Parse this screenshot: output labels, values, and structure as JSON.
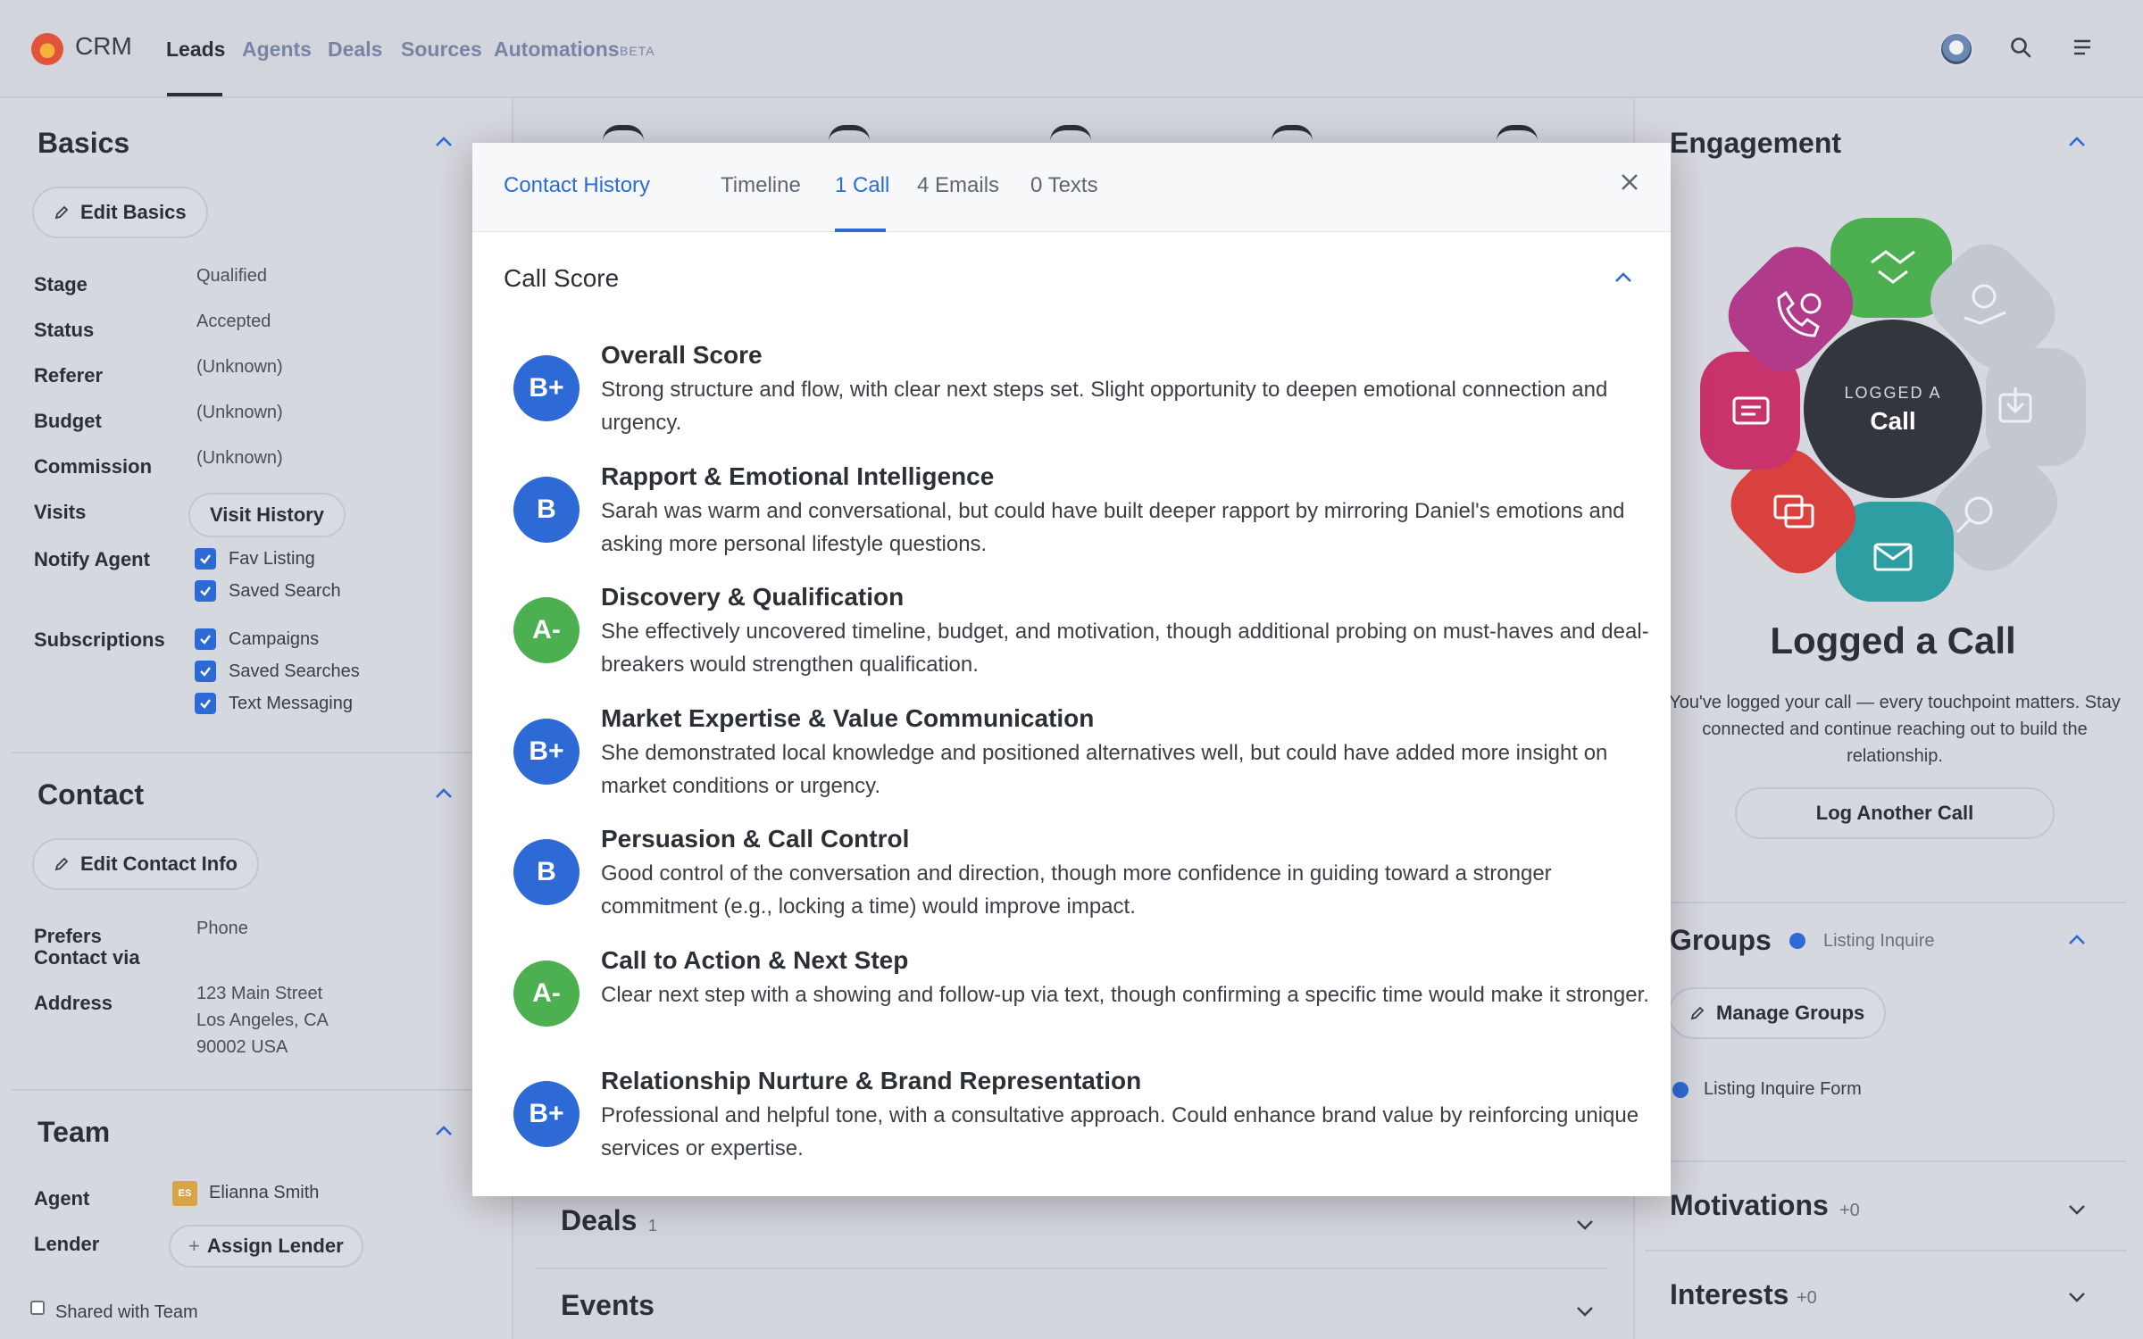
{
  "topnav": {
    "brand": "CRM",
    "items": [
      "Leads",
      "Agents",
      "Deals",
      "Sources",
      "Automations"
    ],
    "beta_badge": "BETA"
  },
  "basics": {
    "title": "Basics",
    "edit_button": "Edit Basics",
    "fields": [
      {
        "label": "Stage",
        "value": "Qualified"
      },
      {
        "label": "Status",
        "value": "Accepted"
      },
      {
        "label": "Referer",
        "value": "(Unknown)"
      },
      {
        "label": "Budget",
        "value": "(Unknown)"
      },
      {
        "label": "Commission",
        "value": "(Unknown)"
      }
    ],
    "visits_label": "Visits",
    "visit_history_button": "Visit History",
    "notify_label": "Notify Agent",
    "notify_options": [
      "Fav Listing",
      "Saved Search"
    ],
    "subscriptions_label": "Subscriptions",
    "subscription_options": [
      "Campaigns",
      "Saved Searches",
      "Text Messaging"
    ]
  },
  "contact": {
    "title": "Contact",
    "edit_button": "Edit Contact Info",
    "prefers_label_1": "Prefers",
    "prefers_label_2": "Contact via",
    "prefers_value": "Phone",
    "address_label": "Address",
    "address_line1": "123 Main Street",
    "address_line2": "Los Angeles, CA",
    "address_line3": "90002 USA"
  },
  "team": {
    "title": "Team",
    "agent_label": "Agent",
    "agent_initials": "ES",
    "agent_name": "Elianna Smith",
    "lender_label": "Lender",
    "assign_lender_button": "Assign Lender",
    "shared_label": "Shared with Team"
  },
  "middle": {
    "deals_title": "Deals",
    "deals_count": "1",
    "events_title": "Events"
  },
  "engagement": {
    "title": "Engagement",
    "center_small": "LOGGED A",
    "center_big": "Call",
    "headline": "Logged a Call",
    "description": "You've logged your call — every touchpoint matters. Stay connected and continue reaching out to build the relationship.",
    "log_button": "Log Another Call",
    "colors": {
      "purple": "#b23a8a",
      "green": "#4caf50",
      "pink": "#c9336c",
      "red": "#d9413f",
      "teal": "#2f9ea2",
      "grey": "#c3c7cf",
      "center": "#33363d"
    }
  },
  "groups": {
    "title": "Groups",
    "tag": "Listing Inquire",
    "manage_button": "Manage Groups",
    "item": "Listing Inquire Form"
  },
  "motivations": {
    "title": "Motivations",
    "count": "+0"
  },
  "interests": {
    "title": "Interests",
    "count": "+0"
  },
  "modal": {
    "tabs": [
      "Contact History",
      "Timeline",
      "1 Call",
      "4 Emails",
      "0 Texts"
    ],
    "section_title": "Call Score",
    "scores": [
      {
        "grade": "B+",
        "title": "Overall Score",
        "desc": "Strong structure and flow, with clear next steps set. Slight opportunity to deepen emotional connection and urgency."
      },
      {
        "grade": "B",
        "title": "Rapport & Emotional Intelligence",
        "desc": "Sarah was warm and conversational, but could have built deeper rapport by mirroring Daniel's emotions and asking more personal lifestyle questions."
      },
      {
        "grade": "A-",
        "title": "Discovery & Qualification",
        "desc": "She effectively uncovered timeline, budget, and motivation, though additional probing on must-haves and deal-breakers would strengthen qualification."
      },
      {
        "grade": "B+",
        "title": "Market Expertise & Value Communication",
        "desc": "She demonstrated local knowledge and positioned alternatives well, but could have added more insight on market conditions or urgency."
      },
      {
        "grade": "B",
        "title": "Persuasion & Call Control",
        "desc": "Good control of the conversation and direction, though more confidence in guiding toward a stronger commitment (e.g., locking a time) would improve impact."
      },
      {
        "grade": "A-",
        "title": "Call to Action & Next Step",
        "desc": "Clear next step with a showing and follow-up via text, though confirming a specific time would make it stronger."
      },
      {
        "grade": "B+",
        "title": "Relationship Nurture & Brand Representation",
        "desc": "Professional and helpful tone, with a consultative approach. Could enhance brand value by reinforcing unique services or expertise."
      }
    ]
  }
}
